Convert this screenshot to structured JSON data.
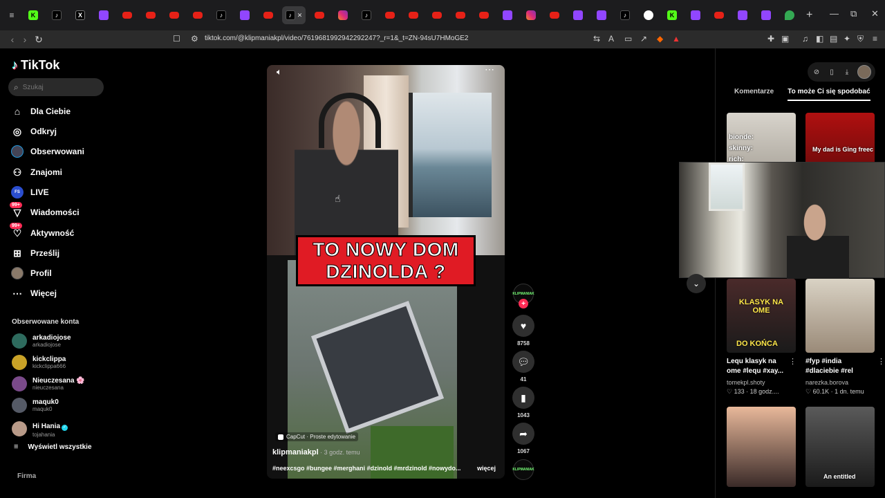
{
  "browser": {
    "url": "tiktok.com/@klipmaniakpl/video/7619681992942292247?_r=1&_t=ZN-94sU7HMoGE2",
    "tabs": [
      "kick",
      "tiktok",
      "x",
      "pen",
      "youtube",
      "youtube",
      "youtube",
      "youtube",
      "tiktok",
      "twitch",
      "youtube",
      "tiktok-active",
      "youtube",
      "instagram",
      "tiktok",
      "youtube",
      "youtube",
      "youtube",
      "youtube",
      "youtube",
      "app",
      "instagram",
      "youtube",
      "app",
      "pen",
      "tiktok",
      "google",
      "kick",
      "app",
      "youtube",
      "twitch",
      "app",
      "maps"
    ],
    "new_tab": "+",
    "window_controls": {
      "minimize": "—",
      "restore": "⧉",
      "close": "✕"
    }
  },
  "sidebar": {
    "logo": "TikTok",
    "search_placeholder": "Szukaj",
    "nav": [
      {
        "label": "Dla Ciebie",
        "icon": "home-icon"
      },
      {
        "label": "Odkryj",
        "icon": "compass-icon"
      },
      {
        "label": "Obserwowani",
        "icon": "avatar-icon"
      },
      {
        "label": "Znajomi",
        "icon": "friends-icon"
      },
      {
        "label": "LIVE",
        "icon": "live-icon"
      },
      {
        "label": "Wiadomości",
        "icon": "messages-icon",
        "badge": "99+"
      },
      {
        "label": "Aktywność",
        "icon": "activity-icon",
        "badge": "99+"
      },
      {
        "label": "Prześlij",
        "icon": "upload-icon"
      },
      {
        "label": "Profil",
        "icon": "profile-icon"
      },
      {
        "label": "Więcej",
        "icon": "more-icon"
      }
    ],
    "following_title": "Obserwowane konta",
    "following": [
      {
        "name": "arkadiojose",
        "handle": "arkadiojose",
        "color": "#2e6b5e"
      },
      {
        "name": "kickclippa",
        "handle": "kickclippa666",
        "color": "#c9a227"
      },
      {
        "name": "Nieuczesana 🌸",
        "handle": "nieuczesana",
        "color": "#7a4a8a"
      },
      {
        "name": "maquk0",
        "handle": "maquk0",
        "color": "#555a66"
      },
      {
        "name": "Hi Hania",
        "handle": "tojahania",
        "color": "#b89a88",
        "verified": true
      }
    ],
    "see_all": "Wyświetl wszystkie",
    "footer": "Firma"
  },
  "video": {
    "overlay_line1": "TO NOWY DOM",
    "overlay_line2": "DZINOLDA ?",
    "capcut": "CapCut · Proste edytowanie",
    "author": "klipmaniakpl",
    "time": " · 3 godz. temu",
    "tags": "#neexcsgo #bungee #merghani #dzinold #mrdzinold #nowydo...",
    "more": "więcej"
  },
  "actions": {
    "avatar_text": "KLIPMANIAK",
    "likes": "8758",
    "comments": "41",
    "saves": "1043",
    "shares": "1067"
  },
  "right_panel": {
    "tabs": [
      "Komentarze",
      "To może Ci się spodobać"
    ],
    "cards": [
      {
        "overlay": "bionde:\nskinny:\nrich:",
        "title": "",
        "user": "",
        "stats": ""
      },
      {
        "overlay": "My dad is Ging freec",
        "title": "",
        "user": "",
        "stats": ""
      },
      {
        "overlay": "KLASYK NA OME",
        "overlay2": "DO KOŃCA",
        "title": "Lequ klasyk na ome #lequ #xay...",
        "user": "tomekpl.shoty",
        "stats": "♡ 133 · 18 godz...."
      },
      {
        "overlay": "",
        "title": "#fyp #india #dlaciebie #rel",
        "user": "narezka.borova",
        "stats": "♡ 60.1K · 1 dn. temu"
      },
      {
        "overlay": "",
        "title": "",
        "user": "",
        "stats": ""
      },
      {
        "overlay": "An entitled",
        "title": "",
        "user": "",
        "stats": ""
      }
    ]
  }
}
